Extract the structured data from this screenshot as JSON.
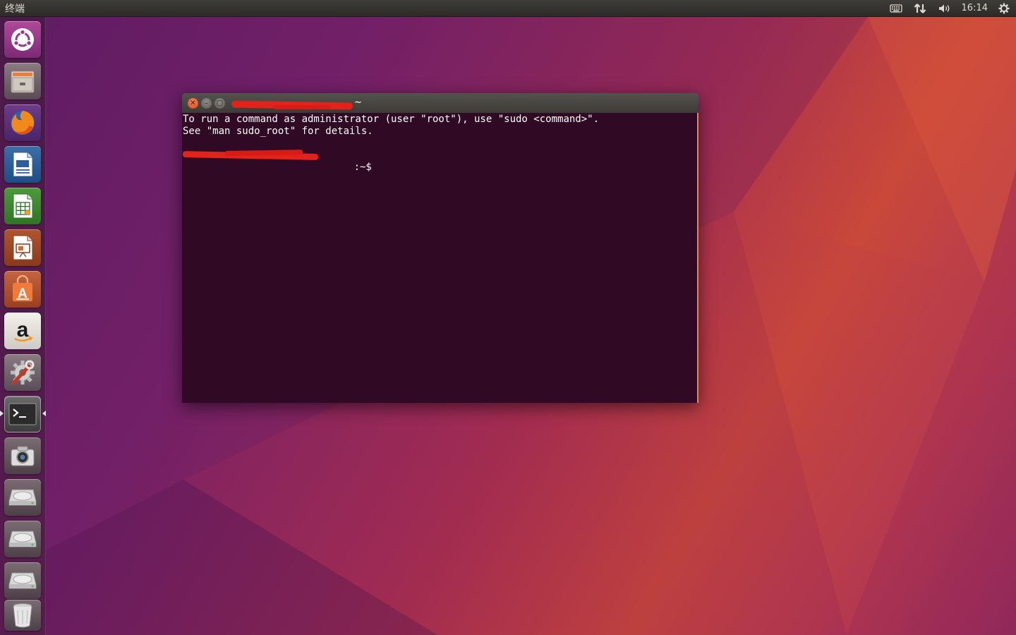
{
  "panel": {
    "app_name": "终端",
    "clock": "16:14",
    "indicators": [
      "keyboard-icon",
      "network-icon",
      "volume-icon",
      "power-settings-icon"
    ]
  },
  "launcher": {
    "items": [
      "ubuntu-dash",
      "files",
      "firefox",
      "libreoffice-writer",
      "libreoffice-calc",
      "libreoffice-impress",
      "ubuntu-software",
      "amazon",
      "system-settings",
      "terminal",
      "camera",
      "drive-1",
      "drive-2",
      "drive-3",
      "trash"
    ],
    "active": "terminal"
  },
  "terminal": {
    "title_suffix": "~",
    "lines": [
      "To run a command as administrator (user \"root\"), use \"sudo <command>\".",
      "See \"man sudo_root\" for details.",
      ""
    ],
    "prompt_suffix": ":~$",
    "colors": {
      "background": "#300a24",
      "text": "#ffffff",
      "prompt_user": "#8ae234"
    }
  },
  "colors": {
    "accent_orange": "#e95420",
    "panel_bg": "#2c2b28"
  }
}
